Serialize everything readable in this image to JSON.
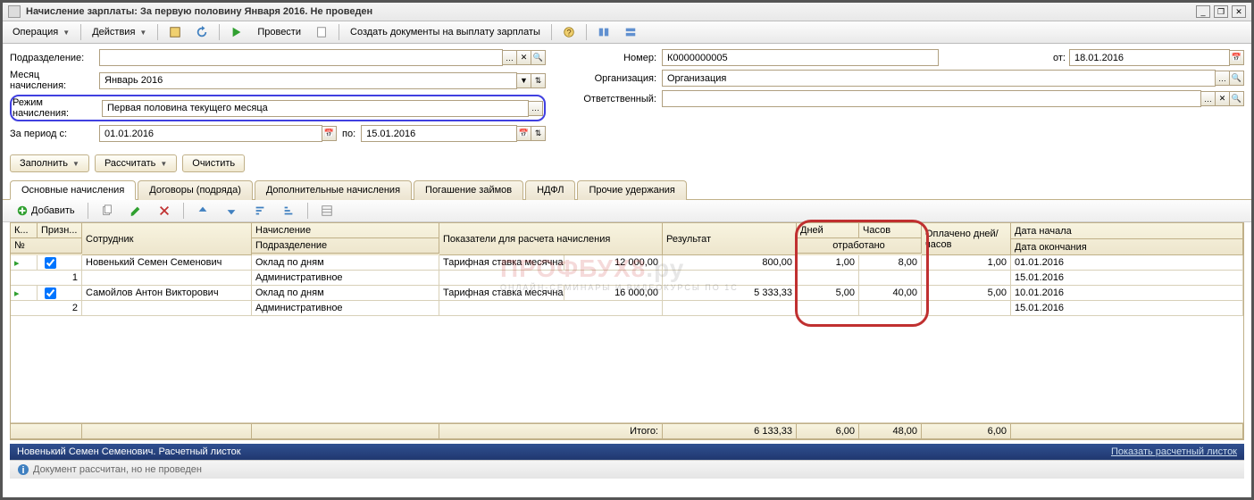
{
  "window": {
    "title": "Начисление зарплаты: За первую половину Января 2016. Не проведен"
  },
  "menu": {
    "operation": "Операция",
    "actions": "Действия",
    "provesti": "Провести",
    "create_docs": "Создать документы на выплату зарплаты"
  },
  "form": {
    "subdiv_lbl": "Подразделение:",
    "month_lbl": "Месяц начисления:",
    "month_val": "Январь 2016",
    "mode_lbl": "Режим начисления:",
    "mode_val": "Первая половина текущего месяца",
    "period_lbl": "За период с:",
    "period_from": "01.01.2016",
    "period_to_lbl": "по:",
    "period_to": "15.01.2016",
    "number_lbl": "Номер:",
    "number_val": "К0000000005",
    "date_lbl": "от:",
    "date_val": "18.01.2016",
    "org_lbl": "Организация:",
    "org_val": "Организация",
    "resp_lbl": "Ответственный:"
  },
  "buttons": {
    "fill": "Заполнить",
    "calc": "Рассчитать",
    "clear": "Очистить",
    "add": "Добавить"
  },
  "tabs": {
    "t1": "Основные начисления",
    "t2": "Договоры (подряда)",
    "t3": "Дополнительные начисления",
    "t4": "Погашение займов",
    "t5": "НДФЛ",
    "t6": "Прочие удержания"
  },
  "grid": {
    "h_k": "К...",
    "h_pr": "Призн...",
    "h_emp": "Сотрудник",
    "h_n": "№",
    "h_acc": "Начисление",
    "h_sub": "Подразделение",
    "h_ind": "Показатели для расчета начисления",
    "h_res": "Результат",
    "h_days": "Дней",
    "h_hours": "Часов",
    "h_worked": "отработано",
    "h_paid": "Оплачено дней/часов",
    "h_dstart": "Дата начала",
    "h_dend": "Дата окончания",
    "rows": [
      {
        "demp": "Новенький Семен Семенович",
        "n": "1",
        "acc": "Оклад по дням",
        "sub": "Административное",
        "ind_l": "Тарифная ставка месячная",
        "ind_v": "12 000,00",
        "res": "800,00",
        "days": "1,00",
        "hours": "8,00",
        "paid": "1,00",
        "d1": "01.01.2016",
        "d2": "15.01.2016"
      },
      {
        "demp": "Самойлов Антон Викторович",
        "n": "2",
        "acc": "Оклад по дням",
        "sub": "Административное",
        "ind_l": "Тарифная ставка месячная",
        "ind_v": "16 000,00",
        "res": "5 333,33",
        "days": "5,00",
        "hours": "40,00",
        "paid": "5,00",
        "d1": "10.01.2016",
        "d2": "15.01.2016"
      }
    ],
    "total_lbl": "Итого:",
    "t_res": "6 133,33",
    "t_days": "6,00",
    "t_hours": "48,00",
    "t_paid": "6,00"
  },
  "status": {
    "s1_left": "Новенький Семен Семенович. Расчетный листок",
    "s1_link": "Показать расчетный листок",
    "s2": "Документ рассчитан, но не проведен"
  },
  "wm": {
    "big": "ПРОФБУХ8",
    "ext": ".ру",
    "sm": "ОНЛАЙН-СЕМИНАРЫ И ВИДЕОКУРСЫ ПО 1С"
  }
}
